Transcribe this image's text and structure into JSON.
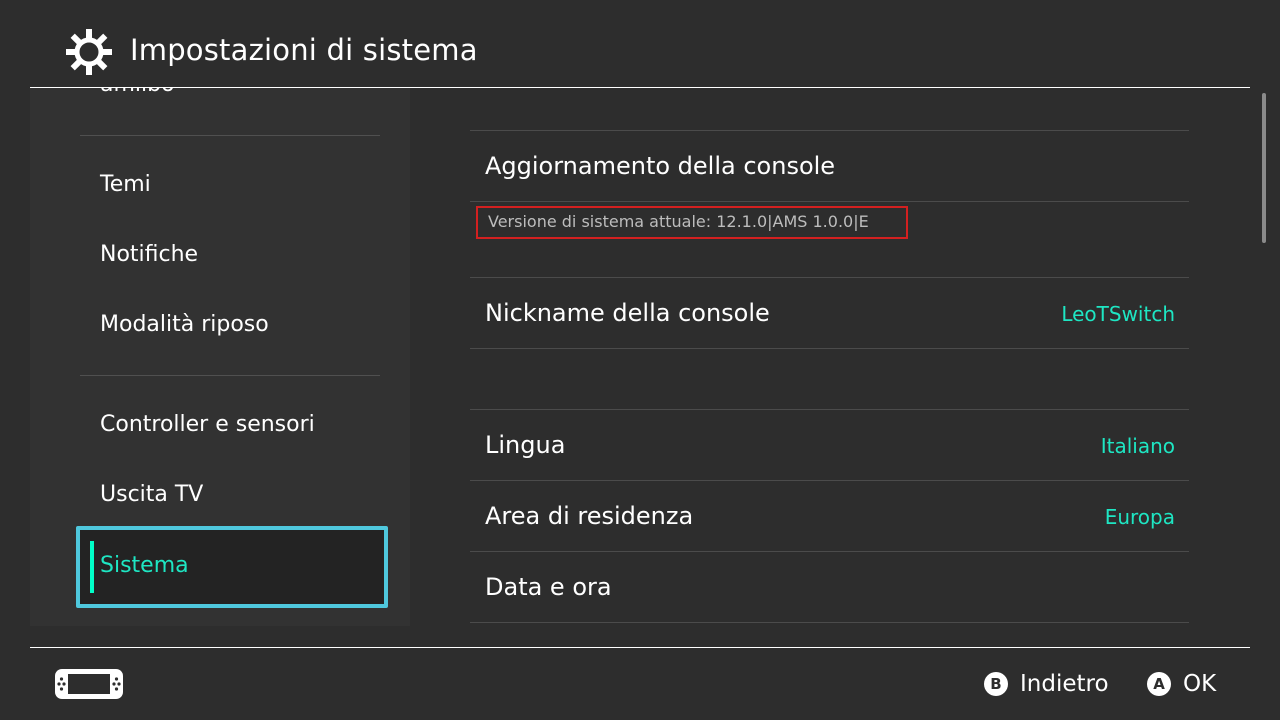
{
  "header": {
    "title": "Impostazioni di sistema",
    "icon": "gear-icon"
  },
  "sidebar": {
    "items": [
      {
        "label": "amiibo"
      },
      {
        "label": "Temi"
      },
      {
        "label": "Notifiche"
      },
      {
        "label": "Modalità riposo"
      },
      {
        "label": "Controller e sensori"
      },
      {
        "label": "Uscita TV"
      },
      {
        "label": "Sistema",
        "selected": true
      }
    ]
  },
  "main": {
    "update_label": "Aggiornamento della console",
    "version_text": "Versione di sistema attuale: 12.1.0|AMS 1.0.0|E",
    "nickname_label": "Nickname della console",
    "nickname_value": "LeoTSwitch",
    "language_label": "Lingua",
    "language_value": "Italiano",
    "region_label": "Area di residenza",
    "region_value": "Europa",
    "datetime_label": "Data e ora"
  },
  "footer": {
    "console_icon": "console-icon",
    "back_button_glyph": "B",
    "back_label": "Indietro",
    "ok_button_glyph": "A",
    "ok_label": "OK"
  },
  "colors": {
    "background": "#2d2d2d",
    "accent": "#1ee6c3",
    "selection_border": "#4fc8dd",
    "highlight_border": "#d32020"
  }
}
